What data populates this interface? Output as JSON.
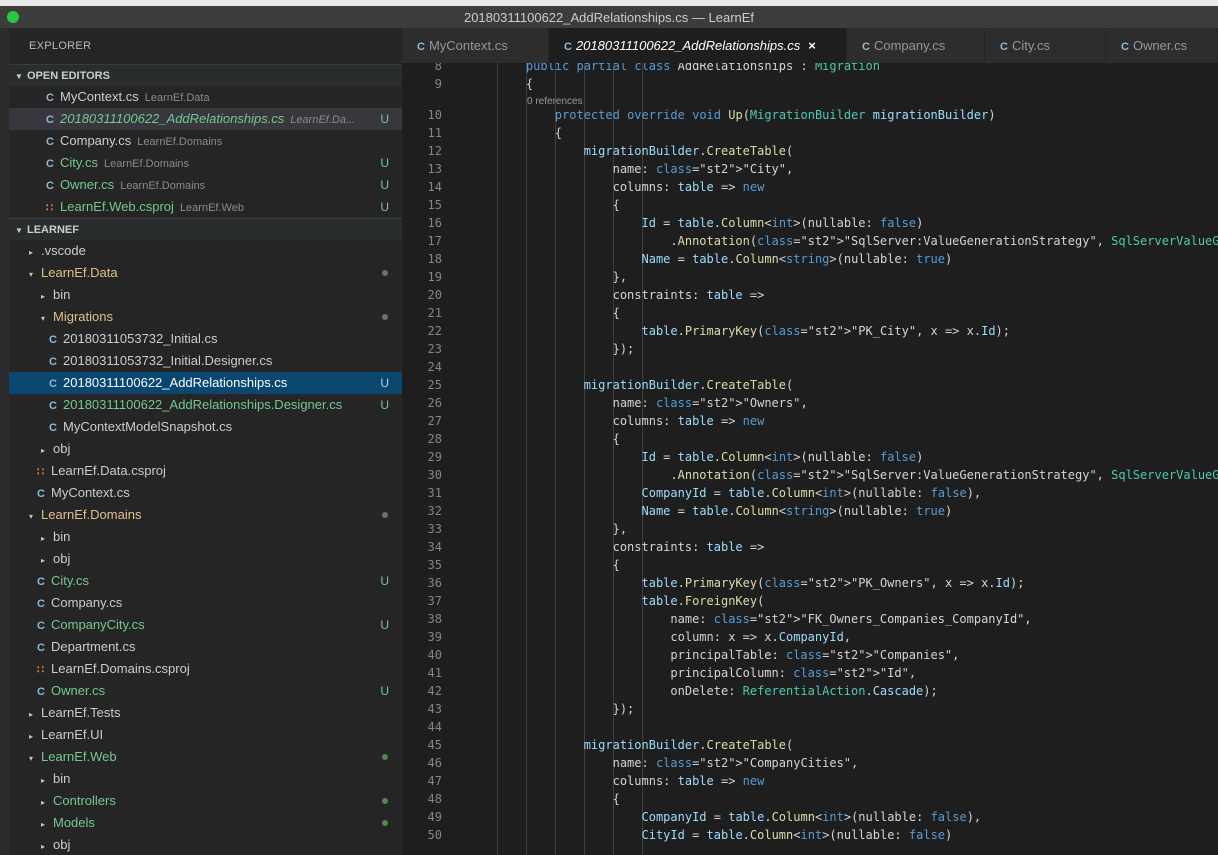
{
  "window": {
    "title": "20180311100622_AddRelationships.cs — LearnEf"
  },
  "explorer": {
    "title": "EXPLORER",
    "open_editors_header": "OPEN EDITORS",
    "project_header": "LEARNEF",
    "open_editors": [
      {
        "name": "MyContext.cs",
        "desc": "LearnEf.Data",
        "icon": "csharp-icon",
        "color": "w",
        "status": ""
      },
      {
        "name": "20180311100622_AddRelationships.cs",
        "desc": "LearnEf.Da...",
        "icon": "csharp-icon",
        "color": "g",
        "status": "U"
      },
      {
        "name": "Company.cs",
        "desc": "LearnEf.Domains",
        "icon": "csharp-icon",
        "color": "w",
        "status": ""
      },
      {
        "name": "City.cs",
        "desc": "LearnEf.Domains",
        "icon": "csharp-icon",
        "color": "g",
        "status": "U"
      },
      {
        "name": "Owner.cs",
        "desc": "LearnEf.Domains",
        "icon": "csharp-icon",
        "color": "g",
        "status": "U"
      },
      {
        "name": "LearnEf.Web.csproj",
        "desc": "LearnEf.Web",
        "icon": "rss-icon",
        "color": "g",
        "status": "U"
      }
    ],
    "tree": [
      {
        "name": ".vscode",
        "twisty": "▸",
        "color": "w"
      },
      {
        "name": "LearnEf.Data",
        "twisty": "▾",
        "color": "o",
        "dot": "grey"
      },
      {
        "name": "bin",
        "twisty": "▸",
        "color": "w"
      },
      {
        "name": "Migrations",
        "twisty": "▾",
        "color": "o",
        "dot": "grey"
      },
      {
        "name": "20180311053732_Initial.cs",
        "color": "w"
      },
      {
        "name": "20180311053732_Initial.Designer.cs",
        "color": "w"
      },
      {
        "name": "20180311100622_AddRelationships.cs",
        "color": "w",
        "status": "U"
      },
      {
        "name": "20180311100622_AddRelationships.Designer.cs",
        "color": "g",
        "status": "U"
      },
      {
        "name": "MyContextModelSnapshot.cs",
        "color": "w"
      },
      {
        "name": "obj",
        "twisty": "▸",
        "color": "w"
      },
      {
        "name": "LearnEf.Data.csproj",
        "color": "w"
      },
      {
        "name": "MyContext.cs",
        "color": "w"
      },
      {
        "name": "LearnEf.Domains",
        "twisty": "▾",
        "color": "o",
        "dot": "grey"
      },
      {
        "name": "bin",
        "twisty": "▸",
        "color": "w"
      },
      {
        "name": "obj",
        "twisty": "▸",
        "color": "w"
      },
      {
        "name": "City.cs",
        "color": "g",
        "status": "U"
      },
      {
        "name": "Company.cs",
        "color": "w"
      },
      {
        "name": "CompanyCity.cs",
        "color": "g",
        "status": "U"
      },
      {
        "name": "Department.cs",
        "color": "w"
      },
      {
        "name": "LearnEf.Domains.csproj",
        "color": "w"
      },
      {
        "name": "Owner.cs",
        "color": "g",
        "status": "U"
      },
      {
        "name": "LearnEf.Tests",
        "twisty": "▸",
        "color": "w"
      },
      {
        "name": "LearnEf.UI",
        "twisty": "▸",
        "color": "w"
      },
      {
        "name": "LearnEf.Web",
        "twisty": "▾",
        "color": "g",
        "dot": "green"
      },
      {
        "name": "bin",
        "twisty": "▸",
        "color": "w"
      },
      {
        "name": "Controllers",
        "twisty": "▸",
        "color": "g",
        "dot": "green"
      },
      {
        "name": "Models",
        "twisty": "▸",
        "color": "g",
        "dot": "green"
      },
      {
        "name": "obj",
        "twisty": "▸",
        "color": "w"
      }
    ]
  },
  "tabs": [
    {
      "label": "MyContext.cs"
    },
    {
      "label": "20180311100622_AddRelationships.cs",
      "close": "×"
    },
    {
      "label": "Company.cs"
    },
    {
      "label": "City.cs"
    },
    {
      "label": "Owner.cs"
    }
  ],
  "editor": {
    "codelens": "0 references",
    "lines": [
      [
        "8",
        "    public partial class AddRelationships : Migration"
      ],
      [
        "9",
        "    {"
      ],
      [
        "10",
        "        protected override void Up(MigrationBuilder migrationBuilder)"
      ],
      [
        "11",
        "        {"
      ],
      [
        "12",
        "            migrationBuilder.CreateTable("
      ],
      [
        "13",
        "                name: \"City\","
      ],
      [
        "14",
        "                columns: table => new"
      ],
      [
        "15",
        "                {"
      ],
      [
        "16",
        "                    Id = table.Column<int>(nullable: false)"
      ],
      [
        "17",
        "                        .Annotation(\"SqlServer:ValueGenerationStrategy\", SqlServerValueGenerationStrateg"
      ],
      [
        "18",
        "                    Name = table.Column<string>(nullable: true)"
      ],
      [
        "19",
        "                },"
      ],
      [
        "20",
        "                constraints: table =>"
      ],
      [
        "21",
        "                {"
      ],
      [
        "22",
        "                    table.PrimaryKey(\"PK_City\", x => x.Id);"
      ],
      [
        "23",
        "                });"
      ],
      [
        "24",
        ""
      ],
      [
        "25",
        "            migrationBuilder.CreateTable("
      ],
      [
        "26",
        "                name: \"Owners\","
      ],
      [
        "27",
        "                columns: table => new"
      ],
      [
        "28",
        "                {"
      ],
      [
        "29",
        "                    Id = table.Column<int>(nullable: false)"
      ],
      [
        "30",
        "                        .Annotation(\"SqlServer:ValueGenerationStrategy\", SqlServerValueGenerationStrateg"
      ],
      [
        "31",
        "                    CompanyId = table.Column<int>(nullable: false),"
      ],
      [
        "32",
        "                    Name = table.Column<string>(nullable: true)"
      ],
      [
        "33",
        "                },"
      ],
      [
        "34",
        "                constraints: table =>"
      ],
      [
        "35",
        "                {"
      ],
      [
        "36",
        "                    table.PrimaryKey(\"PK_Owners\", x => x.Id);"
      ],
      [
        "37",
        "                    table.ForeignKey("
      ],
      [
        "38",
        "                        name: \"FK_Owners_Companies_CompanyId\","
      ],
      [
        "39",
        "                        column: x => x.CompanyId,"
      ],
      [
        "40",
        "                        principalTable: \"Companies\","
      ],
      [
        "41",
        "                        principalColumn: \"Id\","
      ],
      [
        "42",
        "                        onDelete: ReferentialAction.Cascade);"
      ],
      [
        "43",
        "                });"
      ],
      [
        "44",
        ""
      ],
      [
        "45",
        "            migrationBuilder.CreateTable("
      ],
      [
        "46",
        "                name: \"CompanyCities\","
      ],
      [
        "47",
        "                columns: table => new"
      ],
      [
        "48",
        "                {"
      ],
      [
        "49",
        "                    CompanyId = table.Column<int>(nullable: false),"
      ],
      [
        "50",
        "                    CityId = table.Column<int>(nullable: false)"
      ]
    ]
  }
}
